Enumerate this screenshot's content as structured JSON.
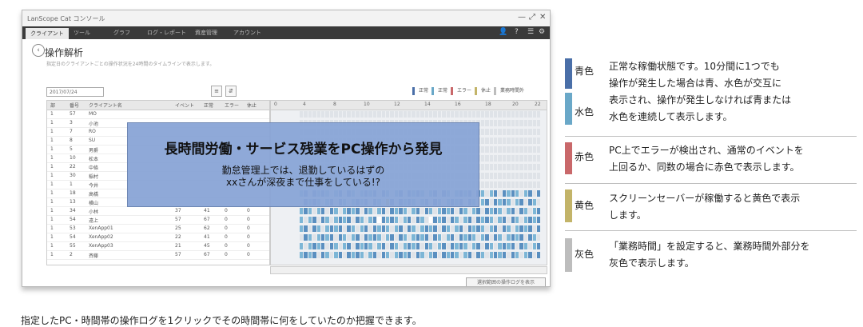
{
  "window": {
    "app_title": "LanScope Cat コンソール",
    "controls": [
      "—",
      "⤢",
      "✕"
    ]
  },
  "nav": {
    "tabs": [
      "クライアント",
      "ツール",
      "グラフ",
      "ログ・レポート",
      "資産管理",
      "アカウント"
    ],
    "icons": [
      "user-icon",
      "help-icon",
      "menu-icon",
      "settings-icon"
    ]
  },
  "page": {
    "title": "操作解析",
    "description": "指定日のクライアントごとの操作状況を24時間のタイムラインで表示します。",
    "date": "2017/07/24",
    "legend_mini": [
      "正常",
      "正常",
      "エラー",
      "休止",
      "業務時間外"
    ],
    "footer_button": "選択範囲の操作ログを表示"
  },
  "table": {
    "headers": [
      "部",
      "番号",
      "クライアント名",
      "イベント",
      "正常",
      "エラー",
      "休止"
    ],
    "rows": [
      [
        "1",
        "57",
        "MO",
        "",
        "",
        "",
        ""
      ],
      [
        "1",
        "3",
        "小池",
        "",
        "",
        "",
        ""
      ],
      [
        "1",
        "7",
        "RO",
        "",
        "",
        "",
        ""
      ],
      [
        "1",
        "8",
        "SU",
        "",
        "",
        "",
        ""
      ],
      [
        "1",
        "5",
        "男爵",
        "",
        "",
        "",
        ""
      ],
      [
        "1",
        "10",
        "松本",
        "",
        "",
        "",
        ""
      ],
      [
        "1",
        "22",
        "中條",
        "",
        "",
        "",
        ""
      ],
      [
        "1",
        "30",
        "稲村",
        "",
        "",
        "",
        ""
      ],
      [
        "1",
        "1",
        "今井",
        "",
        "",
        "",
        ""
      ],
      [
        "1",
        "18",
        "高橋",
        "",
        "",
        "",
        ""
      ],
      [
        "1",
        "13",
        "横山",
        "",
        "",
        "",
        ""
      ],
      [
        "1",
        "34",
        "小林",
        "37",
        "41",
        "0",
        "0"
      ],
      [
        "1",
        "54",
        "遠上",
        "57",
        "67",
        "0",
        "0"
      ],
      [
        "1",
        "53",
        "XenApp01",
        "25",
        "62",
        "0",
        "0"
      ],
      [
        "1",
        "54",
        "XenApp02",
        "22",
        "41",
        "0",
        "0"
      ],
      [
        "1",
        "55",
        "XenApp03",
        "21",
        "45",
        "0",
        "0"
      ],
      [
        "1",
        "2",
        "斉藤",
        "57",
        "67",
        "0",
        "0"
      ]
    ]
  },
  "timeline": {
    "hours": [
      "0",
      "4",
      "8",
      "10",
      "12",
      "14",
      "16",
      "18",
      "20",
      "22"
    ]
  },
  "overlay": {
    "title": "長時間労働・サービス残業をPC操作から発見",
    "line1": "勤怠管理上では、退勤しているはずの",
    "line2": "xxさんが深夜まで仕事をしている!?"
  },
  "legend": [
    {
      "label": "青色",
      "color": "#4a6fa8",
      "lines": [
        "正常な稼働状態です。10分間に1つでも",
        "操作が発生した場合は青、水色が交互に"
      ]
    },
    {
      "label": "水色",
      "color": "#6aa8c8",
      "lines": [
        "表示され、操作が発生しなければ青または",
        "水色を連続して表示します。"
      ]
    },
    {
      "label": "赤色",
      "color": "#c9686a",
      "lines": [
        "PC上でエラーが検出され、通常のイベントを",
        "上回るか、同数の場合に赤色で表示します。"
      ]
    },
    {
      "label": "黄色",
      "color": "#c3b469",
      "lines": [
        "スクリーンセーバーが稼働すると黄色で表示",
        "します。"
      ]
    },
    {
      "label": "灰色",
      "color": "#bdbdbd",
      "lines": [
        "「業務時間」を設定すると、業務時間外部分を",
        "灰色で表示します。"
      ]
    }
  ],
  "caption": "指定したPC・時間帯の操作ログを1クリックでその時間帯に何をしていたのか把握できます。"
}
